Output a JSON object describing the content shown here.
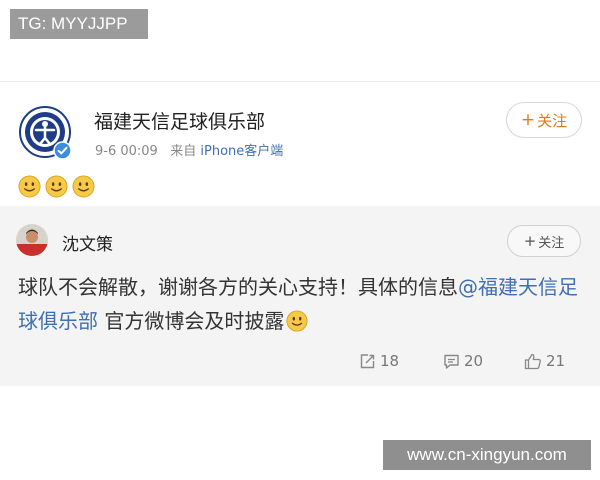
{
  "overlay": {
    "tg_label": "TG: MYYJJPP",
    "watermark": "www.cn-xingyun.com"
  },
  "post": {
    "username": "福建天信足球俱乐部",
    "timestamp": "9-6 00:09",
    "source_prefix": "来自",
    "source_client": "iPhone客户端",
    "follow_label": "关注",
    "emoji_icons": [
      "smile-emoji",
      "smile-emoji",
      "smile-emoji"
    ]
  },
  "repost": {
    "username": "沈文策",
    "follow_label": "关注",
    "text_part1": "球队不会解散，谢谢各方的关心支持！具体的信息",
    "mention": "@福建天信足球俱乐部",
    "text_part2": " 官方微博会及时披露",
    "reposts": "18",
    "comments": "20",
    "likes": "21"
  },
  "colors": {
    "link_blue": "#3f6fb0",
    "follow_orange": "#e07b1a",
    "repost_bg": "#f4f4f4"
  }
}
